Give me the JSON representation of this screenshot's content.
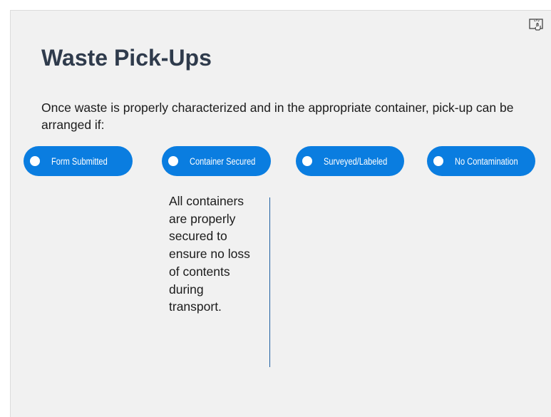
{
  "slide": {
    "title": "Waste Pick-Ups",
    "intro": "Once waste is properly characterized and in the appropriate container, pick-up can be arranged if:",
    "interaction_icon": "touch-interaction-icon",
    "tabs": [
      {
        "label": "Form Submitted"
      },
      {
        "label": "Container Secured"
      },
      {
        "label": "Surveyed/Labeled"
      },
      {
        "label": "No Contamination"
      }
    ],
    "active_detail": "All containers are properly secured to ensure no loss of contents during transport."
  },
  "colors": {
    "accent": "#0a7de0",
    "title": "#2f3b4c",
    "divider": "#1e5fa3",
    "background": "#f1f1f1"
  }
}
